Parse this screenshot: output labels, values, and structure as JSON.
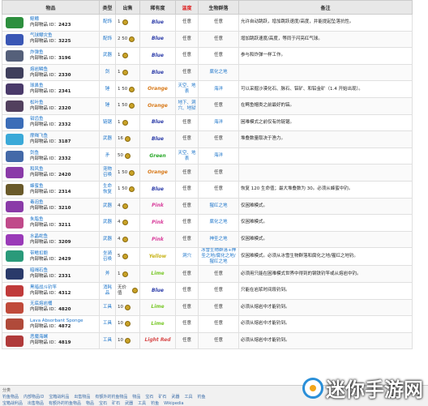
{
  "headers": {
    "item": "物品",
    "type": "类型",
    "sell": "出售",
    "rarity": "稀有度",
    "temp": "温度",
    "env": "生物群落",
    "notes": "备注"
  },
  "rows": [
    {
      "name": "鲸鳔",
      "id_label": "内部物品 ID：",
      "id": "2423",
      "type": "配饰",
      "sell": "1",
      "rarity": "Blue",
      "temp": "任意",
      "env": "任意",
      "notes": "允许自动跳跃，增加跳跃速度/高度，并能提起坠落抗性。",
      "icon_color": "#2d8f3e"
    },
    {
      "name": "气球鳔灾鱼",
      "id_label": "内部物品 ID：",
      "id": "3225",
      "type": "配饰",
      "sell": "2 50",
      "rarity": "Blue",
      "temp": "任意",
      "env": "任意",
      "notes": "增加跳跃速度/高度，等同于闪亮红气球。",
      "icon_color": "#3a57b5"
    },
    {
      "name": "炸弹鱼",
      "id_label": "内部物品 ID：",
      "id": "3196",
      "type": "武器",
      "sell": "1",
      "rarity": "Blue",
      "temp": "任意",
      "env": "任意",
      "notes": "参与和炸弹一样工作。",
      "icon_color": "#55607a"
    },
    {
      "name": "熔岩鳞鱼",
      "id_label": "内部物品 ID：",
      "id": "2330",
      "type": "剑",
      "sell": "1",
      "rarity": "Blue",
      "temp": "任意",
      "env": "腐化之地",
      "notes": "",
      "icon_color": "#3f3f5c"
    },
    {
      "name": "球鼻鱼",
      "id_label": "内部物品 ID：",
      "id": "2341",
      "type": "锤",
      "sell": "1 50",
      "rarity": "Orange",
      "temp": "天空、地表",
      "env": "海洋",
      "notes": "可以采掘沙漠化石、脉石、铝矿、和铅金矿（1.4 开始出现）。",
      "icon_color": "#4a3a6a"
    },
    {
      "name": "松叶鱼",
      "id_label": "内部物品 ID：",
      "id": "2320",
      "type": "锤",
      "sell": "1 50",
      "rarity": "Orange",
      "temp": "地下、洞穴、地狱",
      "env": "任意",
      "notes": "在鳄鱼帽类之前最好的镐。",
      "icon_color": "#52405e"
    },
    {
      "name": "钳齿鱼",
      "id_label": "内部物品 ID：",
      "id": "2332",
      "type": "链锯",
      "sell": "1",
      "rarity": "Blue",
      "temp": "任意",
      "env": "海洋",
      "notes": "困难模式之前仅有的链锯。",
      "icon_color": "#3b6db8"
    },
    {
      "name": "摩羯飞鱼",
      "id_label": "内部物品 ID：",
      "id": "3187",
      "type": "武器",
      "sell": "16",
      "rarity": "Blue",
      "temp": "任意",
      "env": "任意",
      "notes": "堆叠数量取决于渔力。",
      "icon_color": "#3aa9d8"
    },
    {
      "name": "剑鱼",
      "id_label": "内部物品 ID：",
      "id": "2332",
      "type": "矛",
      "sell": "50",
      "rarity": "Green",
      "temp": "天空、地表",
      "env": "海洋",
      "notes": "",
      "icon_color": "#4469a8"
    },
    {
      "name": "和风鱼",
      "id_label": "内部物品 ID：",
      "id": "2420",
      "type": "宠物召唤",
      "sell": "1 50",
      "rarity": "Orange",
      "temp": "任意",
      "env": "任意",
      "notes": "",
      "icon_color": "#8a3aa8"
    },
    {
      "name": "蜂蜜鱼",
      "id_label": "内部物品 ID：",
      "id": "2314",
      "type": "生命恢复",
      "sell": "1 50",
      "rarity": "Blue",
      "temp": "任意",
      "env": "任意",
      "notes": "恢复 120 生命值；最大堆叠数为 30。必须从蜂蜜中钓。",
      "icon_color": "#6a5a2a"
    },
    {
      "name": "毒泡鱼",
      "id_label": "内部物品 ID：",
      "id": "3210",
      "type": "武器",
      "sell": "4",
      "rarity": "Pink",
      "temp": "任意",
      "env": "猩红之地",
      "notes": "仅困难模式。",
      "icon_color": "#8a3aa8"
    },
    {
      "name": "朱脂鱼",
      "id_label": "内部物品 ID：",
      "id": "3211",
      "type": "武器",
      "sell": "4",
      "rarity": "Pink",
      "temp": "任意",
      "env": "腐化之地",
      "notes": "仅困难模式。",
      "icon_color": "#c04a8a"
    },
    {
      "name": "水晶蛇鱼",
      "id_label": "内部物品 ID：",
      "id": "3209",
      "type": "武器",
      "sell": "4",
      "rarity": "Pink",
      "temp": "任意",
      "env": "神圣之地",
      "notes": "仅困难模式。",
      "icon_color": "#9a3ab8"
    },
    {
      "name": "带鳍扣鲍",
      "id_label": "内部物品 ID：",
      "id": "2429",
      "type": "坐骑召唤",
      "sell": "5",
      "rarity": "Yellow",
      "temp": "洞穴",
      "env": "冰雪生物群落+神圣之地/腐化之地/猩红之地",
      "notes": "仅困难模式。必须从冰雪生物群落和腐化之地/猩红之地钓。",
      "icon_color": "#2a9a7a"
    },
    {
      "name": "暗褐石鱼",
      "id_label": "内部物品 ID：",
      "id": "2331",
      "type": "斧",
      "sell": "1",
      "rarity": "Lime",
      "temp": "任意",
      "env": "任意",
      "notes": "必须用只能在困难模式世界中得到的钢铁钓竿或从熔岩中钓。",
      "icon_color": "#2a3a6a"
    },
    {
      "name": "黑暗战斗钓竿",
      "id_label": "内部物品 ID：",
      "id": "4312",
      "type": "消耗品",
      "sell": "无价值",
      "rarity": "Blue",
      "temp": "任意",
      "env": "任意",
      "notes": "只能在岩浆时间段钓到。",
      "icon_color": "#c03a3a"
    },
    {
      "name": "无底熔岩桶",
      "id_label": "内部物品 ID：",
      "id": "4820",
      "type": "工具",
      "sell": "10",
      "rarity": "Lime",
      "temp": "任意",
      "env": "任意",
      "notes": "必须从熔岩中才能钓到。",
      "icon_color": "#c04a3a"
    },
    {
      "name": "Lava Absorbant Sponge",
      "id_label": "内部物品 ID：",
      "id": "4872",
      "type": "工具",
      "sell": "10",
      "rarity": "Lime",
      "temp": "任意",
      "env": "任意",
      "notes": "必须从熔岩中才能钓到。",
      "icon_color": "#b04a3a"
    },
    {
      "name": "恶魔海螺",
      "id_label": "内部物品 ID：",
      "id": "4819",
      "type": "工具",
      "sell": "10",
      "rarity": "Light Red",
      "temp": "任意",
      "env": "任意",
      "notes": "必须从熔岩中才能钓到。",
      "icon_color": "#b03a3a"
    }
  ],
  "footer": {
    "row1": "分类",
    "row2": [
      "钓鱼物品",
      "内部物品ID",
      "宝箱战利品",
      "出售物品",
      "有额外的钓鱼物品",
      "物品",
      "宝石",
      "矿石",
      "武器",
      "工具",
      "钓鱼"
    ],
    "row3": [
      "宝箱战利品",
      "出售物品",
      "有额外的钓鱼物品",
      "物品",
      "宝石",
      "矿石",
      "武器",
      "工具",
      "钓鱼",
      "Wikipedia"
    ]
  },
  "watermark": {
    "text": "迷你手游网"
  },
  "colors": {
    "Blue": "#2a3aa8",
    "Orange": "#d87a1a",
    "Green": "#2aa82a",
    "Pink": "#d83a9a",
    "Yellow": "#c8b41a",
    "Lime": "#7ac82a",
    "Light Red": "#d84a4a"
  }
}
